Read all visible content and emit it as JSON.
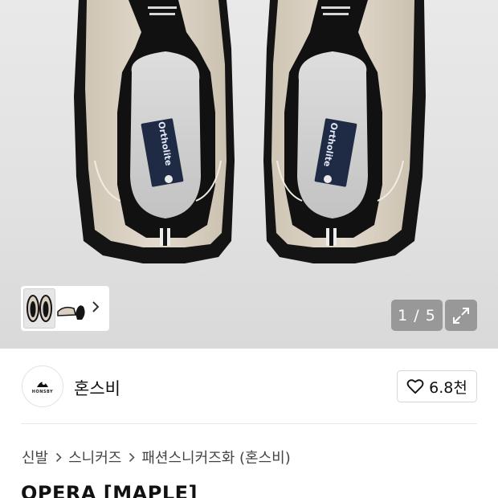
{
  "gallery": {
    "counter_current": "1",
    "counter_separator": "/",
    "counter_total": "5",
    "counter_text": "1 / 5",
    "insole_label": "Ortholite",
    "thumb_next_icon": "chevron-right-icon",
    "expand_icon": "expand-arrows-icon"
  },
  "brand": {
    "name": "혼스비",
    "logo_text": "HONSBY",
    "like_count": "6.8천",
    "like_icon": "heart-outline-icon"
  },
  "breadcrumb": {
    "items": [
      "신발",
      "스니커즈",
      "패션스니커즈화 (혼스비)"
    ],
    "separator_icon": "chevron-right-icon"
  },
  "product": {
    "title": "OPERA [MAPLE]"
  },
  "colors": {
    "shoe_beige": "#d9d0c1",
    "shoe_black": "#141414",
    "insole_grey": "#cfcfcf",
    "badge_navy": "#1f2a44",
    "overlay_grey": "#8c8c8c"
  }
}
